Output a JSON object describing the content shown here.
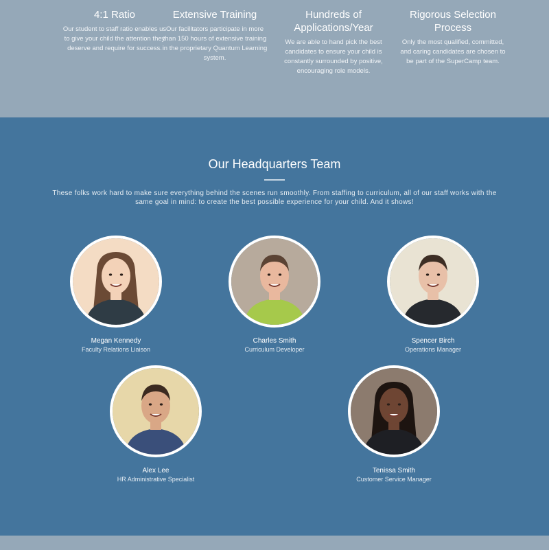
{
  "features": [
    {
      "title_line1": "4:1 Ratio",
      "title_line2": "",
      "text_lines": [
        "Our student to staff ratio enables us",
        "to give your child the attention they",
        "deserve and require for success."
      ]
    },
    {
      "title_line1": "Extensive Training",
      "title_line2": "",
      "text_lines": [
        "Our facilitators participate in more",
        "than 150 hours of extensive training",
        "in the proprietary Quantum Learning",
        "system."
      ]
    },
    {
      "title_line1": "Hundreds of",
      "title_line2": "Applications/Year",
      "text_lines": [
        "We are able to hand pick the best",
        "candidates to ensure your child is",
        "constantly surrounded by positive,",
        "encouraging role models."
      ]
    },
    {
      "title_line1": "Rigorous Selection",
      "title_line2": "Process",
      "text_lines": [
        "Only the most qualified, committed,",
        "and caring candidates are chosen to",
        "be part of the SuperCamp team."
      ]
    }
  ],
  "hq": {
    "title": "Our Headquarters Team",
    "desc_line1": "These folks work hard to make sure everything behind the scenes run smoothly. From staffing to curriculum, all of our staff works with the",
    "desc_line2": "same goal in mind: to create the best possible experience for your child. And it shows!"
  },
  "team": [
    {
      "name": "Megan Kennedy",
      "role": "Faculty Relations Liaison",
      "bg": "#f4dcc4",
      "skin": "#f3d2b8",
      "hair": "#6b4a35",
      "shirt": "#2f3c45"
    },
    {
      "name": "Charles Smith",
      "role": "Curriculum Developer",
      "bg": "#b7aa9c",
      "skin": "#e9b89e",
      "hair": "#5b4334",
      "shirt": "#a6c94b"
    },
    {
      "name": "Spencer Birch",
      "role": "Operations Manager",
      "bg": "#e9e3d3",
      "skin": "#e8c0a8",
      "hair": "#3d2e24",
      "shirt": "#26292e"
    },
    {
      "name": "Alex Lee",
      "role": "HR Administrative Specialist",
      "bg": "#e7d7a9",
      "skin": "#d9a786",
      "hair": "#3b2a20",
      "shirt": "#3a4f7a"
    },
    {
      "name": "Tenissa Smith",
      "role": "Customer Service Manager",
      "bg": "#8c7b6e",
      "skin": "#6e4533",
      "hair": "#1d1410",
      "shirt": "#1e1f24"
    }
  ]
}
